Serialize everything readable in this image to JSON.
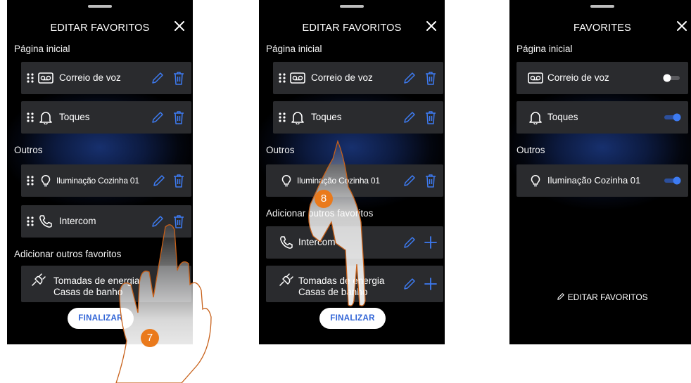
{
  "screen1": {
    "title": "EDITAR FAVORITOS",
    "section_home": "Página inicial",
    "section_others": "Outros",
    "section_add": "Adicionar outros favoritos",
    "items_home": [
      "Correio de voz",
      "Toques"
    ],
    "items_others": [
      "Iluminação Cozinha 01",
      "Intercom"
    ],
    "add_item_line1": "Tomadas de energia",
    "add_item_line2": "Casas de banho",
    "finish_label": "FINALIZAR",
    "step": "7"
  },
  "screen2": {
    "title": "EDITAR FAVORITOS",
    "section_home": "Página inicial",
    "section_others": "Outros",
    "section_add": "Adicionar outros favoritos",
    "items_home": [
      "Correio de voz",
      "Toques"
    ],
    "items_others": [
      "Iluminação Cozinha 01"
    ],
    "add_items": [
      "Intercom"
    ],
    "add_item_line1": "Tomadas de energia",
    "add_item_line2": "Casas de banho",
    "finish_label": "FINALIZAR",
    "step": "8"
  },
  "screen3": {
    "title": "FAVORITES",
    "section_home": "Página inicial",
    "section_others": "Outros",
    "items": [
      {
        "label": "Correio de voz",
        "toggle_on": false
      },
      {
        "label": "Toques",
        "toggle_on": true
      },
      {
        "label": "Iluminação Cozinha 01",
        "toggle_on": true
      }
    ],
    "edit_link": "EDITAR FAVORITOS"
  },
  "colors": {
    "accent": "#3d7bf2",
    "card": "#2a2b2e",
    "step_badge": "#ea7a1c",
    "hand_outline": "#c8611a"
  }
}
